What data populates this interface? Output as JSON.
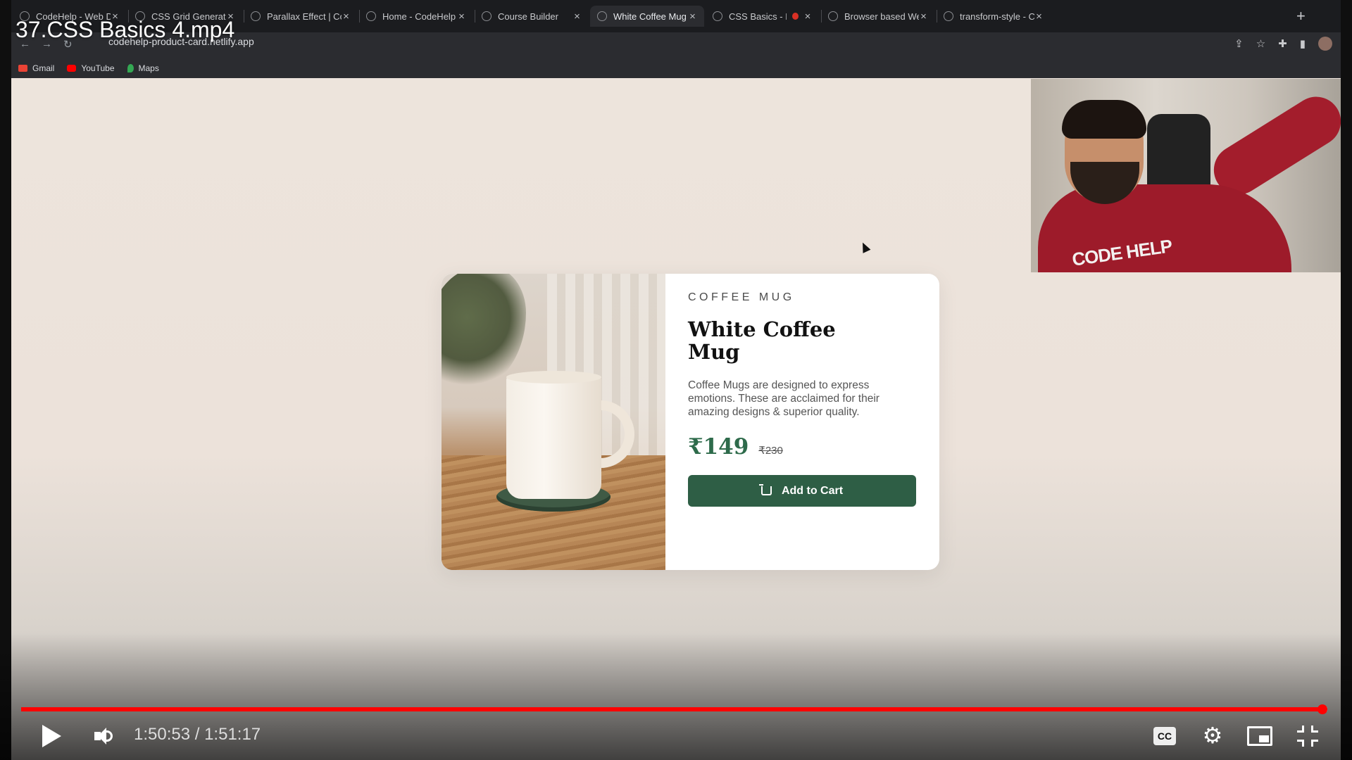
{
  "video": {
    "title": "37.CSS Basics 4.mp4",
    "current_time": "1:50:53",
    "duration": "1:51:17",
    "time_display": "1:50:53 / 1:51:17",
    "progress_fraction": 0.9964
  },
  "browser": {
    "tabs": [
      {
        "title": "CodeHelp - Web Dev",
        "icon": "codehelp-icon"
      },
      {
        "title": "CSS Grid Generator",
        "icon": "grid-icon"
      },
      {
        "title": "Parallax Effect | CodeHelp",
        "icon": "codehelp-icon"
      },
      {
        "title": "Home - CodeHelp",
        "icon": "codehelp-icon"
      },
      {
        "title": "Course Builder",
        "icon": "course-builder-icon"
      },
      {
        "title": "White Coffee Mug",
        "icon": "globe-icon",
        "active": true
      },
      {
        "title": "CSS Basics - IV",
        "icon": "course-builder-icon"
      },
      {
        "title": "",
        "icon": "recording-icon"
      },
      {
        "title": "Browser based WebRTC",
        "icon": "globe-icon"
      },
      {
        "title": "transform-style - CSS:",
        "icon": "mdn-icon"
      }
    ],
    "url": "codehelp-product-card.netlify.app",
    "bookmarks": [
      {
        "label": "Gmail",
        "color": "#ea4335"
      },
      {
        "label": "YouTube",
        "color": "#ff0000"
      },
      {
        "label": "Maps",
        "color": "#34a853"
      }
    ]
  },
  "product": {
    "category": "COFFEE MUG",
    "title": "White Coffee Mug",
    "description": "Coffee Mugs are designed to express emotions. These are acclaimed for their amazing designs & superior quality.",
    "price": "₹149",
    "old_price": "₹230",
    "button_label": "Add to Cart"
  },
  "webcam": {
    "logo_text": "CODE HELP"
  },
  "player": {
    "cc_label": "CC"
  },
  "colors": {
    "accent_green": "#2e5e45",
    "price_green": "#2e6b4b",
    "progress_red": "#ff0000"
  }
}
